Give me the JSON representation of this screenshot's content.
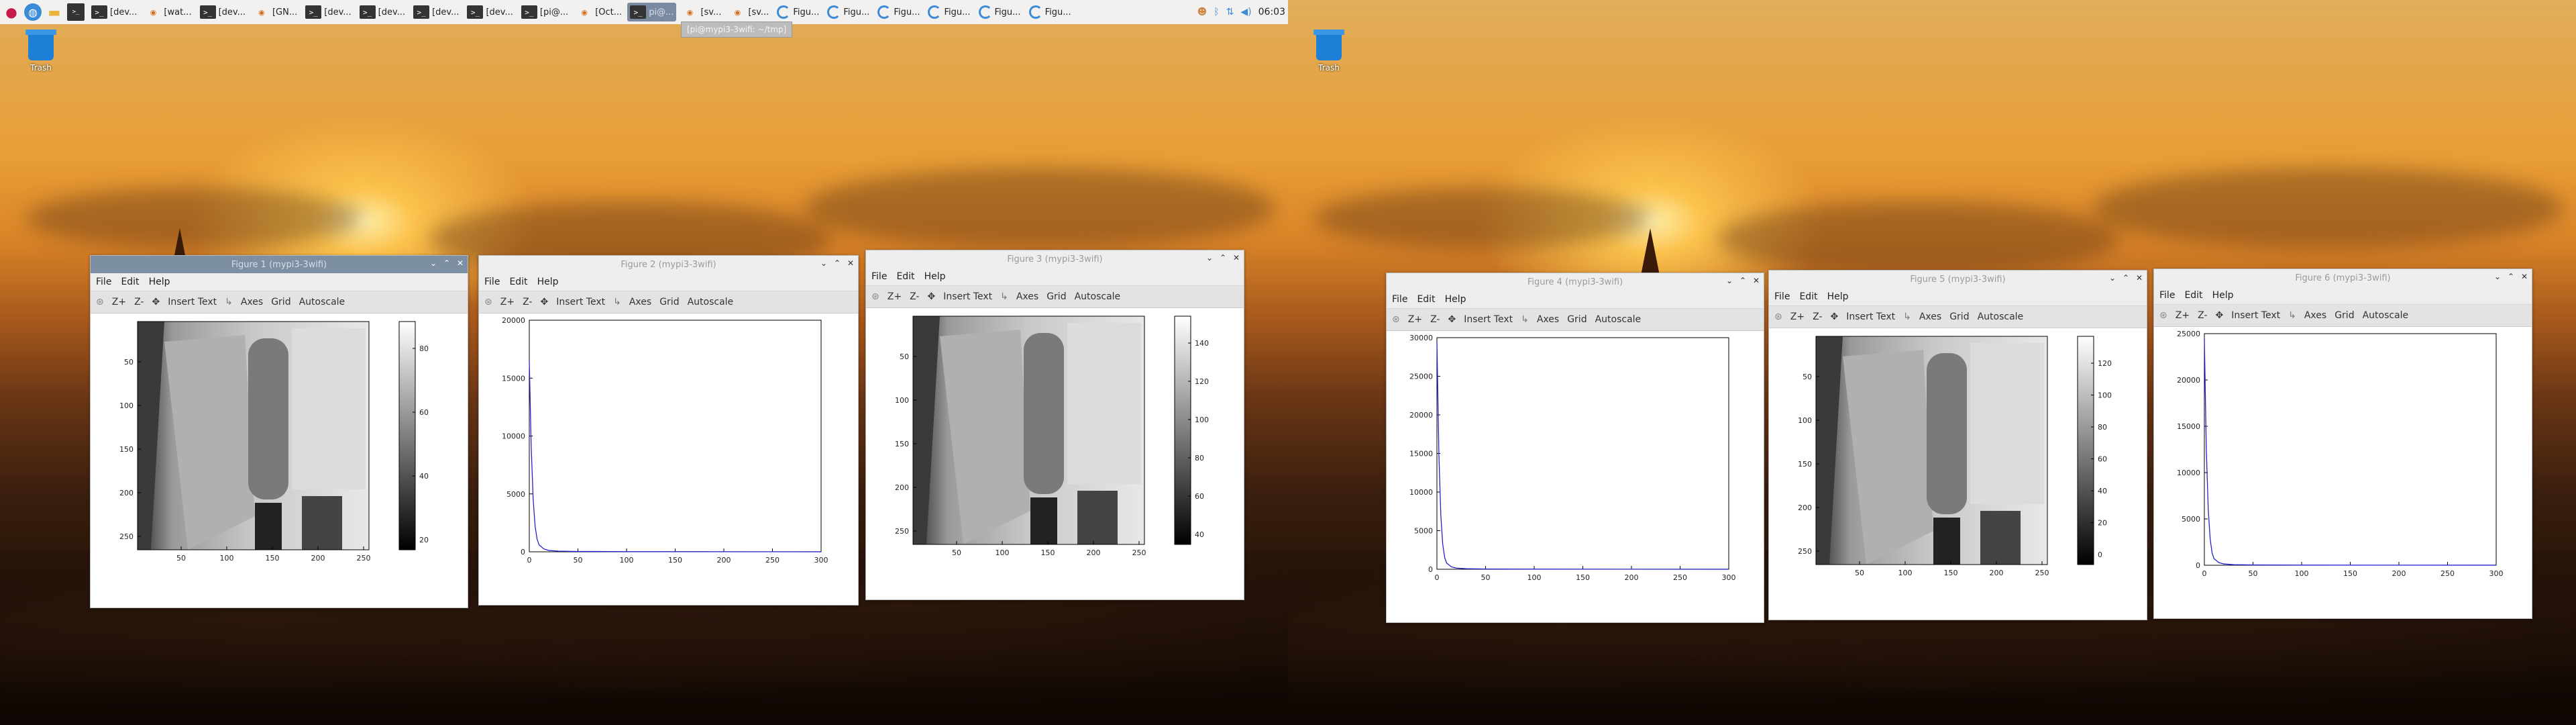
{
  "taskbar": {
    "buttons": [
      "[dev...",
      "[wat...",
      "[dev...",
      "[GN...",
      "[dev...",
      "[dev...",
      "[dev...",
      "[dev...",
      "[pi@...",
      "[Oct...",
      "pi@...",
      "[sv...",
      "[sv...",
      "Figu...",
      "Figu...",
      "Figu...",
      "Figu...",
      "Figu...",
      "Figu..."
    ],
    "clock": "06:03"
  },
  "tooltip": "[pi@mypi3-3wifi: ~/tmp]",
  "desktop": {
    "trash_label": "Trash"
  },
  "menu": {
    "file": "File",
    "edit": "Edit",
    "help": "Help"
  },
  "toolbar": {
    "zoom_in": "Z+",
    "zoom_out": "Z-",
    "insert_text": "Insert Text",
    "axes": "Axes",
    "grid": "Grid",
    "autoscale": "Autoscale"
  },
  "windows": [
    {
      "title": "Figure 1 (mypi3-3wifi)",
      "kind": "image",
      "active": true,
      "yticks": [
        "50",
        "100",
        "150",
        "200",
        "250"
      ],
      "xticks": [
        "50",
        "100",
        "150",
        "200",
        "250"
      ],
      "cbar": [
        "80",
        "60",
        "40",
        "20"
      ]
    },
    {
      "title": "Figure 2 (mypi3-3wifi)",
      "kind": "line",
      "yticks": [
        "20000",
        "15000",
        "10000",
        "5000",
        "0"
      ],
      "xticks": [
        "0",
        "50",
        "100",
        "150",
        "200",
        "250",
        "300"
      ]
    },
    {
      "title": "Figure 3 (mypi3-3wifi)",
      "kind": "image",
      "yticks": [
        "50",
        "100",
        "150",
        "200",
        "250"
      ],
      "xticks": [
        "50",
        "100",
        "150",
        "200",
        "250"
      ],
      "cbar": [
        "140",
        "120",
        "100",
        "80",
        "60",
        "40"
      ]
    },
    {
      "title": "Figure 4 (mypi3-3wifi)",
      "kind": "line",
      "yticks": [
        "30000",
        "25000",
        "20000",
        "15000",
        "10000",
        "5000",
        "0"
      ],
      "xticks": [
        "0",
        "50",
        "100",
        "150",
        "200",
        "250",
        "300"
      ]
    },
    {
      "title": "Figure 5 (mypi3-3wifi)",
      "kind": "image",
      "yticks": [
        "50",
        "100",
        "150",
        "200",
        "250"
      ],
      "xticks": [
        "50",
        "100",
        "150",
        "200",
        "250"
      ],
      "cbar": [
        "120",
        "100",
        "80",
        "60",
        "40",
        "20",
        "0"
      ]
    },
    {
      "title": "Figure 6 (mypi3-3wifi)",
      "kind": "line",
      "yticks": [
        "25000",
        "20000",
        "15000",
        "10000",
        "5000",
        "0"
      ],
      "xticks": [
        "0",
        "50",
        "100",
        "150",
        "200",
        "250",
        "300"
      ]
    }
  ],
  "chart_data": [
    {
      "type": "line",
      "figure": "Figure 2",
      "x": [
        0,
        2,
        4,
        6,
        8,
        10,
        15,
        20,
        30,
        50,
        100,
        300
      ],
      "y": [
        16500,
        9000,
        4500,
        2200,
        1100,
        600,
        250,
        120,
        60,
        30,
        15,
        5
      ],
      "xlim": [
        0,
        300
      ],
      "ylim": [
        0,
        20000
      ]
    },
    {
      "type": "line",
      "figure": "Figure 4",
      "x": [
        0,
        2,
        4,
        6,
        8,
        10,
        15,
        20,
        30,
        50,
        100,
        300
      ],
      "y": [
        29500,
        15000,
        7000,
        3200,
        1500,
        800,
        300,
        150,
        70,
        30,
        15,
        5
      ],
      "xlim": [
        0,
        300
      ],
      "ylim": [
        0,
        30000
      ]
    },
    {
      "type": "line",
      "figure": "Figure 6",
      "x": [
        0,
        2,
        4,
        6,
        8,
        10,
        15,
        20,
        30,
        50,
        100,
        300
      ],
      "y": [
        24500,
        12500,
        6000,
        2800,
        1300,
        700,
        280,
        140,
        60,
        30,
        15,
        5
      ],
      "xlim": [
        0,
        300
      ],
      "ylim": [
        0,
        25000
      ]
    }
  ],
  "colors": {
    "line": "#2222cc",
    "titlebar_active": "#7d8fa3"
  }
}
